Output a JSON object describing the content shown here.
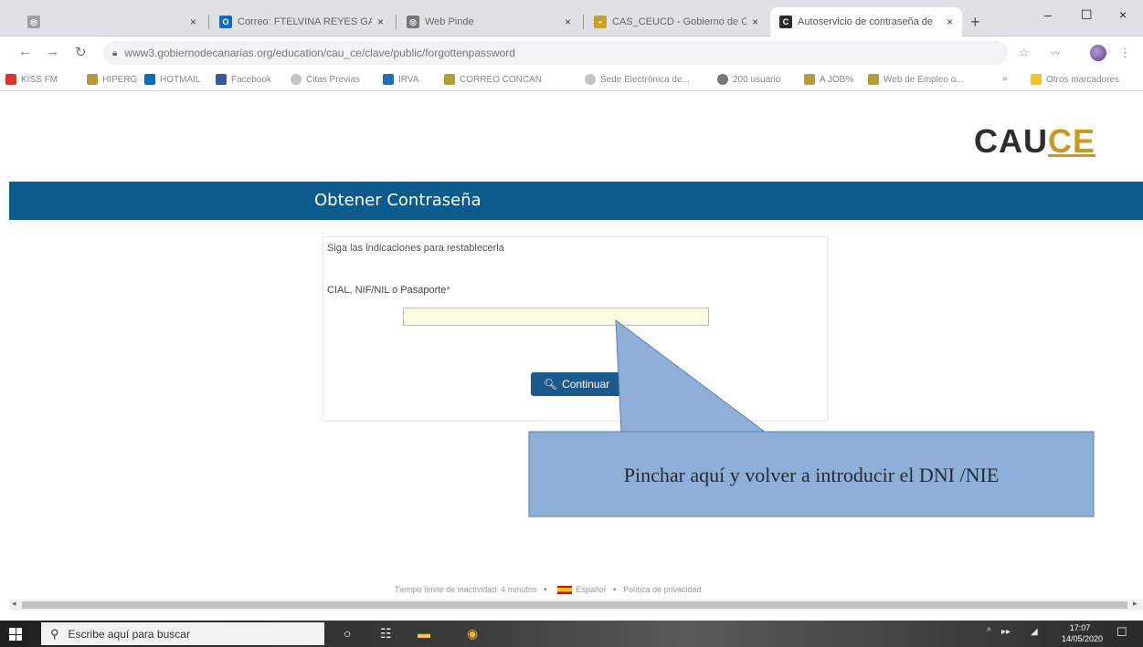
{
  "browser": {
    "tabs": [
      {
        "label": "",
        "icon": "globe-icon"
      },
      {
        "label": "Correo: FTELVINA REYES GARC",
        "icon": "outlook-icon"
      },
      {
        "label": "Web Pinde",
        "icon": "globe-icon"
      },
      {
        "label": "CAS_CEUCD - Gobierno de Ca",
        "icon": "document-icon"
      },
      {
        "label": "Autoservicio de contraseña de",
        "icon": "cauce-icon",
        "active": true
      }
    ],
    "new_tab": "+",
    "window_controls": {
      "minimize": "–",
      "maximize": "☐",
      "close": "×"
    },
    "url": "www3.gobiernodecanarias.org/education/cau_ce/clave/public/forgottenpassword",
    "bookmarks": [
      "KISS FM",
      "HIPERG",
      "HOTMAIL",
      "Facebook",
      "Citas Previas",
      "IRVA",
      "CORREO CONCAN",
      "Sede Electrónica de...",
      "200 usuario",
      "A JOB%",
      "Web de Empleo o..."
    ],
    "bookmarks_more": "»",
    "other_bookmarks": "Otros marcadores"
  },
  "page": {
    "logo_main": "CAU",
    "logo_accent": "CE",
    "title": "Obtener Contraseña",
    "instructions": "Siga las indicaciones para restablecerla",
    "field_label": "CIAL, NIF/NIL o Pasaporte",
    "field_required_mark": "*",
    "field_value": "",
    "continue_label": "Continuar",
    "callout": "Pinchar  aquí y volver a introducir el DNI /NIE",
    "footer": {
      "timeout": "Tiempo límite de inactividad: 4 minutos",
      "language": "Español",
      "privacy": "Política de privacidad"
    }
  },
  "taskbar": {
    "search_placeholder": "Escribe aquí para buscar",
    "time": "17:07",
    "date": "14/05/2020"
  },
  "colors": {
    "header_bar": "#0d5b8c",
    "button": "#1c5a8d",
    "callout_fill": "#8fb0d6",
    "logo_accent": "#c89a1d"
  }
}
